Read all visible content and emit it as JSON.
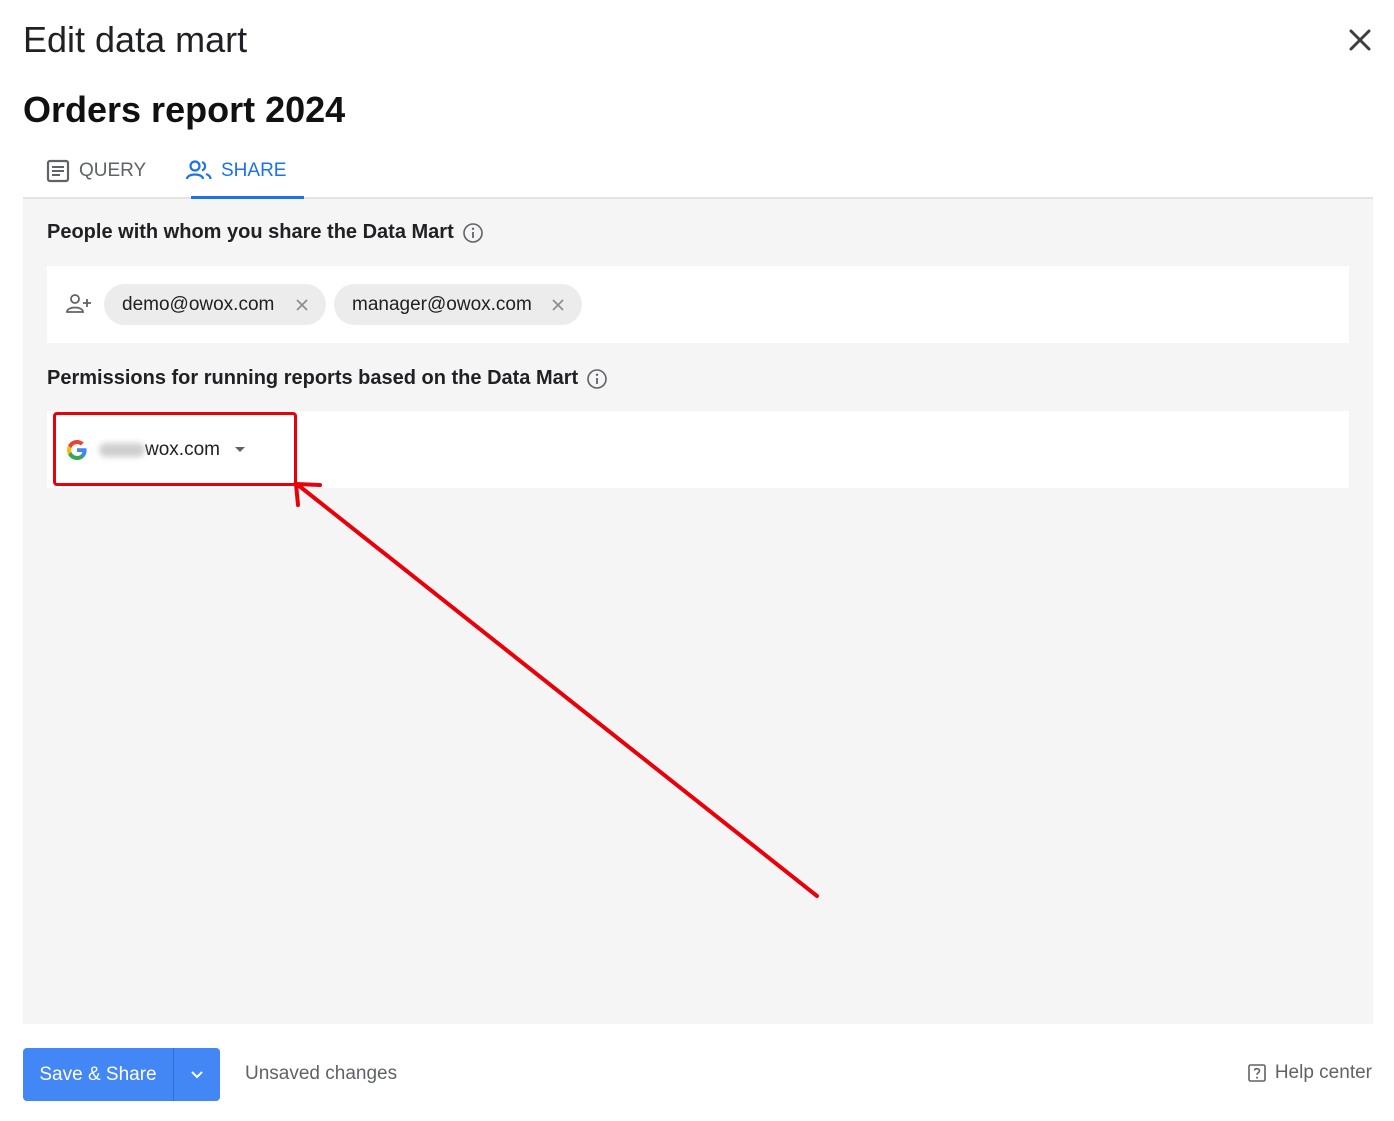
{
  "dialog": {
    "title": "Edit data mart",
    "mart_name": "Orders report 2024"
  },
  "tabs": [
    {
      "label": "QUERY",
      "icon": "document-icon",
      "active": false
    },
    {
      "label": "SHARE",
      "icon": "people-icon",
      "active": true
    }
  ],
  "share": {
    "people_label": "People with whom you share the Data Mart",
    "people": [
      "demo@owox.com",
      "manager@owox.com"
    ],
    "permissions_label": "Permissions for running reports based on the Data Mart",
    "account": {
      "provider_icon": "google-icon",
      "domain": "wox.com"
    }
  },
  "annotation": {
    "highlight_color": "#e8000b"
  },
  "footer": {
    "save_label": "Save & Share",
    "status": "Unsaved changes",
    "help_label": "Help center"
  },
  "colors": {
    "accent": "#1a73e8",
    "primary_button": "#4287f5"
  }
}
